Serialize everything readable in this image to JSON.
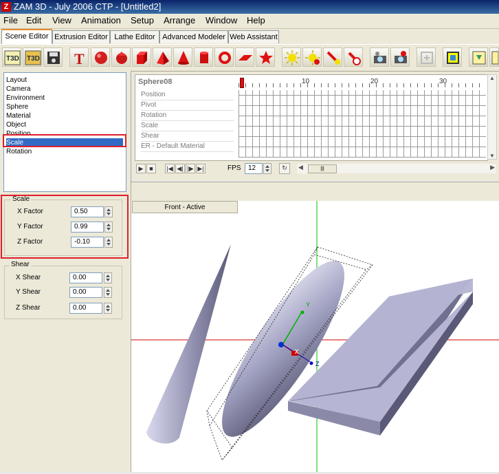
{
  "window": {
    "title": "ZAM 3D - July 2006 CTP - [Untitled2]",
    "logo": "Z"
  },
  "menu": [
    "File",
    "Edit",
    "View",
    "Animation",
    "Setup",
    "Arrange",
    "Window",
    "Help"
  ],
  "tabs": [
    "Scene Editor",
    "Extrusion Editor",
    "Lathe Editor",
    "Advanced Modeler",
    "Web Assistant"
  ],
  "toolbar": {
    "icons": [
      "t3d-new-icon",
      "t3d-open-icon",
      "save-icon",
      "text-icon",
      "sphere-icon",
      "cone-sphere-icon",
      "cube-icon",
      "pyramid-icon",
      "cone-icon",
      "cylinder-icon",
      "torus-icon",
      "plane-icon",
      "star-icon",
      "light-icon",
      "light2-icon",
      "spotlight-icon",
      "spotlight2-icon",
      "camera-icon",
      "camera2-icon",
      "disabled-tool-icon",
      "group-icon",
      "export-icon",
      "export2-icon"
    ]
  },
  "property_list": {
    "items": [
      "Layout",
      "Camera",
      "Environment",
      "Sphere",
      "Material",
      "Object",
      "Position",
      "Scale",
      "Rotation"
    ],
    "selected": "Scale"
  },
  "scale_group": {
    "title": "Scale",
    "fields": [
      {
        "label": "X Factor",
        "value": "0.50"
      },
      {
        "label": "Y Factor",
        "value": "0.99"
      },
      {
        "label": "Z Factor",
        "value": "-0.10"
      }
    ]
  },
  "shear_group": {
    "title": "Shear",
    "fields": [
      {
        "label": "X Shear",
        "value": "0.00"
      },
      {
        "label": "Y Shear",
        "value": "0.00"
      },
      {
        "label": "Z Shear",
        "value": "0.00"
      }
    ]
  },
  "timeline": {
    "object_name": "Sphere08",
    "tracks": [
      "Position",
      "Pivot",
      "Rotation",
      "Scale",
      "Shear",
      "ER - Default Material"
    ],
    "ruler_numbers": [
      "10",
      "20",
      "30"
    ],
    "fps_label": "FPS",
    "fps_value": "12"
  },
  "viewport": {
    "tab_label": "Front - Active",
    "axis_labels": [
      "Y",
      "X",
      "Z"
    ]
  },
  "colors": {
    "highlight_box": "#e01e2a",
    "selection": "#316ac5",
    "axis_green": "#00c000",
    "axis_red": "#d00000"
  }
}
